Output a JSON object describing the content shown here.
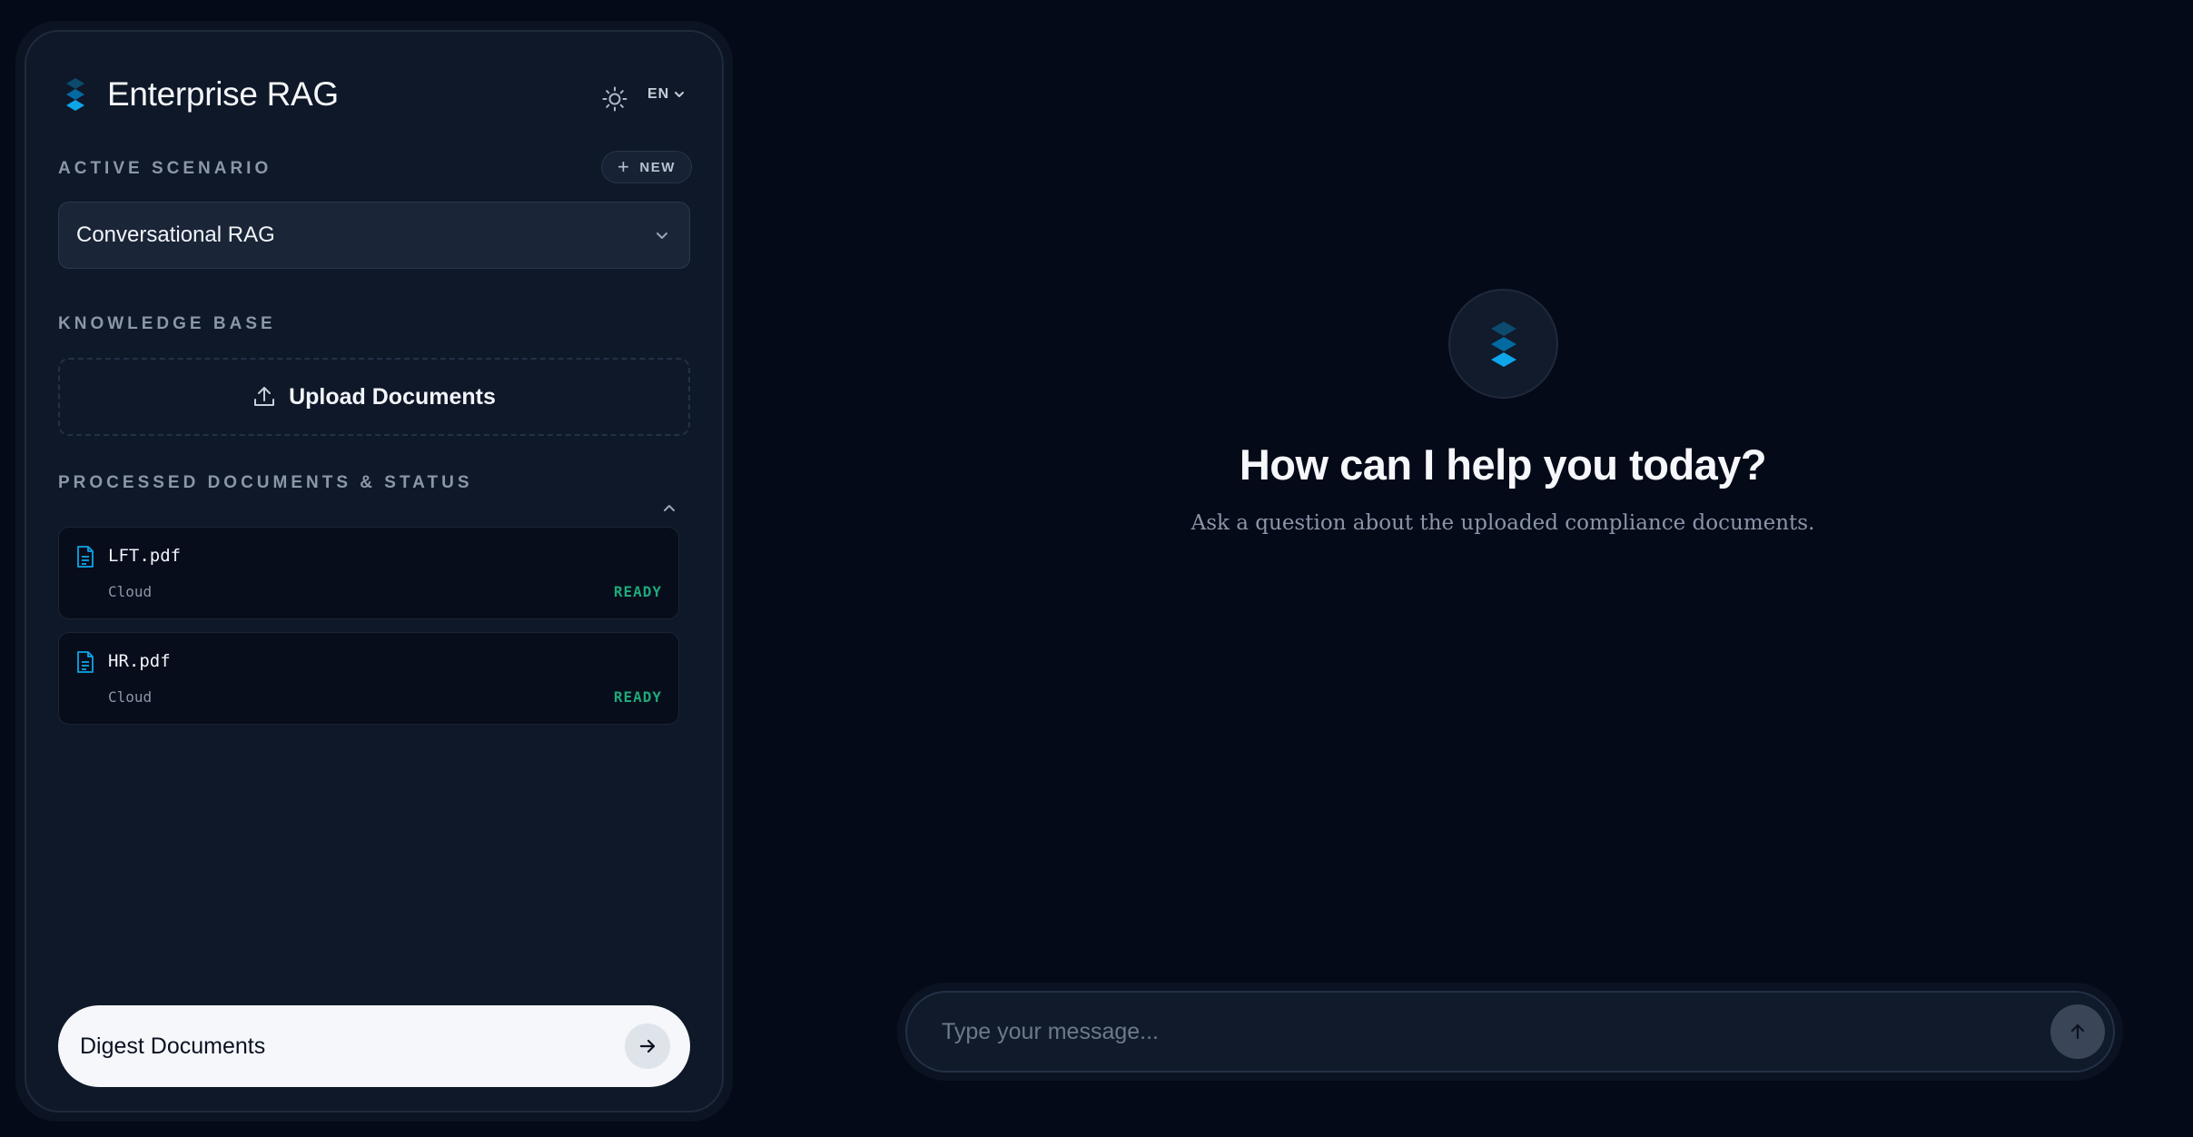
{
  "brand": {
    "title": "Enterprise RAG",
    "logo_icon": "layers-icon"
  },
  "header": {
    "theme_icon": "sun-icon",
    "language": "EN"
  },
  "scenario": {
    "section_label": "ACTIVE SCENARIO",
    "new_label": "NEW",
    "selected": "Conversational RAG"
  },
  "knowledge_base": {
    "section_label": "KNOWLEDGE BASE",
    "upload_label": "Upload Documents"
  },
  "processed": {
    "section_label": "PROCESSED DOCUMENTS & STATUS",
    "documents": [
      {
        "name": "LFT.pdf",
        "source": "Cloud",
        "status": "READY"
      },
      {
        "name": "HR.pdf",
        "source": "Cloud",
        "status": "READY"
      }
    ]
  },
  "digest": {
    "label": "Digest Documents"
  },
  "main": {
    "title": "How can I help you today?",
    "subtitle": "Ask a question about the uploaded compliance documents."
  },
  "composer": {
    "placeholder": "Type your message..."
  },
  "colors": {
    "background": "#050a18",
    "sidebar": "#0f1828",
    "accent": "#0ea5e9",
    "ready": "#1fa87a"
  }
}
